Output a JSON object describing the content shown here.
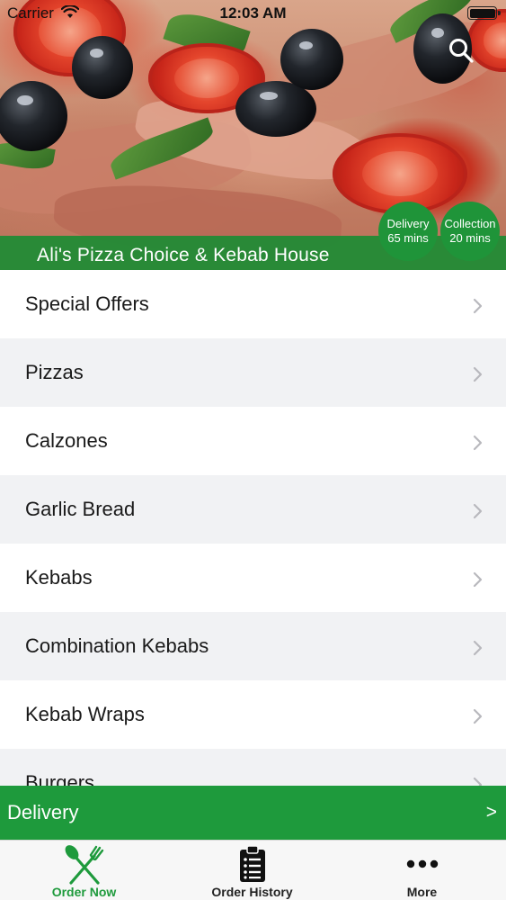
{
  "status_bar": {
    "carrier": "Carrier",
    "time": "12:03 AM"
  },
  "header": {
    "restaurant_name": "Ali's Pizza Choice & Kebab House",
    "delivery_badge": {
      "label": "Delivery",
      "time": "65 mins"
    },
    "collection_badge": {
      "label": "Collection",
      "time": "20 mins"
    },
    "search_icon": "search-icon"
  },
  "menu": {
    "items": [
      {
        "label": "Special Offers"
      },
      {
        "label": "Pizzas"
      },
      {
        "label": "Calzones"
      },
      {
        "label": "Garlic Bread"
      },
      {
        "label": "Kebabs"
      },
      {
        "label": "Combination Kebabs"
      },
      {
        "label": "Kebab Wraps"
      },
      {
        "label": "Burgers"
      }
    ]
  },
  "delivery_bar": {
    "label": "Delivery",
    "arrow": ">"
  },
  "tab_bar": {
    "tabs": [
      {
        "label": "Order Now",
        "icon": "fork-knife-icon",
        "active": true
      },
      {
        "label": "Order History",
        "icon": "clipboard-list-icon",
        "active": false
      },
      {
        "label": "More",
        "icon": "more-dots-icon",
        "active": false
      }
    ]
  },
  "colors": {
    "brand_green": "#1e9a3c",
    "row_alt": "#f1f2f4"
  }
}
